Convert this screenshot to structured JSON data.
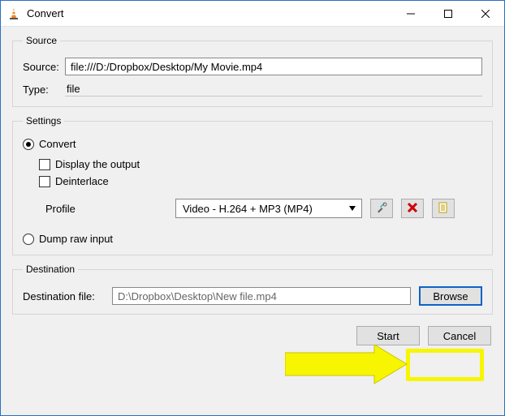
{
  "window": {
    "title": "Convert"
  },
  "source": {
    "legend": "Source",
    "source_label": "Source:",
    "source_value": "file:///D:/Dropbox/Desktop/My Movie.mp4",
    "type_label": "Type:",
    "type_value": "file"
  },
  "settings": {
    "legend": "Settings",
    "convert_label": "Convert",
    "display_output_label": "Display the output",
    "deinterlace_label": "Deinterlace",
    "profile_label": "Profile",
    "profile_value": "Video - H.264 + MP3 (MP4)",
    "dump_label": "Dump raw input"
  },
  "destination": {
    "legend": "Destination",
    "label": "Destination file:",
    "value": "D:\\Dropbox\\Desktop\\New file.mp4",
    "browse_label": "Browse"
  },
  "actions": {
    "start": "Start",
    "cancel": "Cancel"
  },
  "icons": {
    "tools": "tools-icon",
    "delete": "delete-icon",
    "new": "new-profile-icon"
  }
}
